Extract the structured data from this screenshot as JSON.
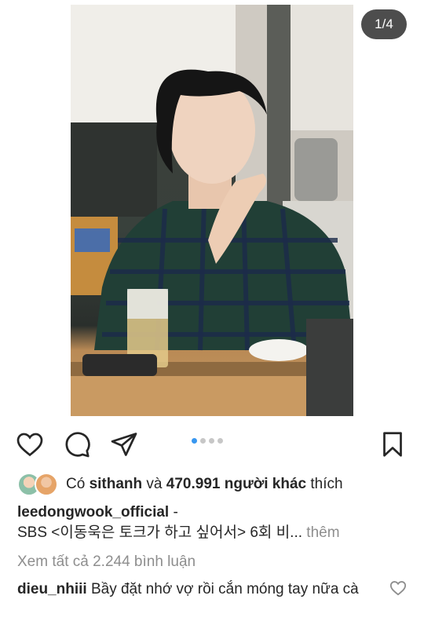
{
  "post": {
    "page_counter": "1/4",
    "carousel": {
      "total": 4,
      "active_index": 0
    }
  },
  "likes": {
    "prefix": "Có",
    "user": "sithanh",
    "and": "và",
    "count": "470.991 người khác",
    "suffix": "thích"
  },
  "caption": {
    "username": "leedongwook_official",
    "dash": "-",
    "text": "SBS <이동욱은 토크가 하고 싶어서> 6회 비...",
    "more_label": "thêm"
  },
  "comments": {
    "view_all_label": "Xem tất cả 2.244 bình luận",
    "items": [
      {
        "username": "dieu_nhiii",
        "text": "Bầy đặt nhớ vợ rồi cắn móng tay nữa cà"
      }
    ]
  },
  "icons": {
    "like": "heart-icon",
    "comment": "comment-icon",
    "share": "paper-plane-icon",
    "save": "bookmark-icon",
    "comment_like": "heart-small-icon"
  },
  "colors": {
    "active_dot": "#3897f0",
    "inactive_dot": "#c7c7c7",
    "text": "#262626",
    "muted": "#8e8e8e"
  }
}
